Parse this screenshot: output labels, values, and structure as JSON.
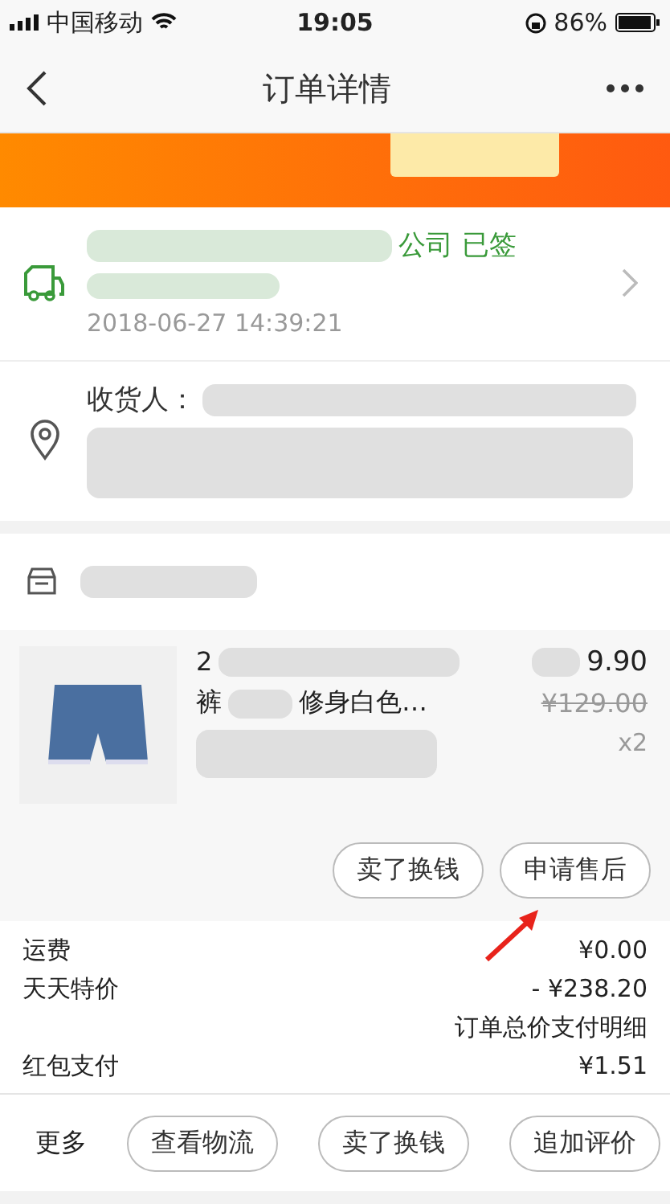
{
  "status_bar": {
    "carrier": "中国移动",
    "time": "19:05",
    "battery": "86%"
  },
  "nav": {
    "title": "订单详情"
  },
  "logistics": {
    "status_text": "公司 已签",
    "time": "2018-06-27 14:39:21"
  },
  "address": {
    "label": "收货人："
  },
  "product": {
    "title_start": "2",
    "title_second": "裤",
    "title_end": "修身白色…",
    "price": "9.90",
    "original_price": "¥129.00",
    "quantity": "x2"
  },
  "product_actions": [
    {
      "label": "卖了换钱"
    },
    {
      "label": "申请售后"
    }
  ],
  "fees": [
    {
      "kind": "line",
      "label": "运费",
      "value": "¥0.00"
    },
    {
      "kind": "line",
      "label": "天天特价",
      "value": "- ¥238.20"
    },
    {
      "kind": "note",
      "value": "订单总价支付明细"
    },
    {
      "kind": "line",
      "label": "红包支付",
      "value": "¥1.51"
    }
  ],
  "bottom_bar": {
    "more": "更多",
    "buttons": [
      {
        "label": "查看物流"
      },
      {
        "label": "卖了换钱"
      },
      {
        "label": "追加评价"
      }
    ]
  }
}
